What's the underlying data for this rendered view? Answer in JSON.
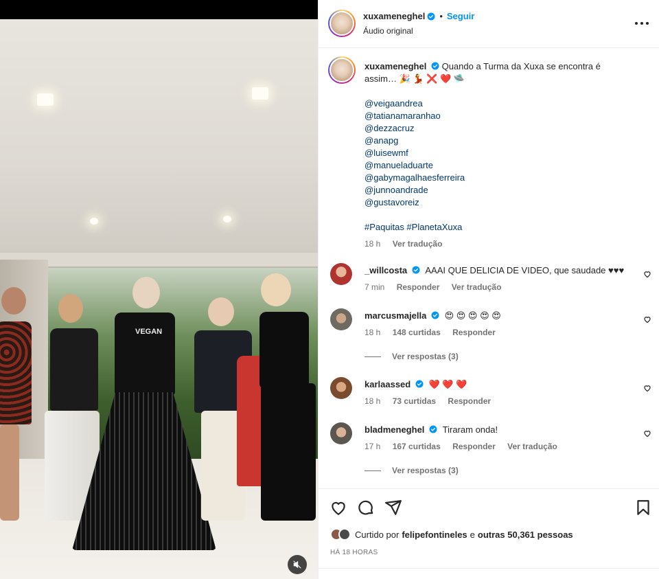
{
  "post": {
    "username": "xuxameneghel",
    "follow_label": "Seguir",
    "separator": "•",
    "audio_label": "Áudio original",
    "caption_line1": "Quando a Turma da Xuxa se encontra é",
    "caption_line2": "assim… 🎉 💃 ❌ ❤️ 🛸",
    "mentions": [
      "@veigaandrea",
      "@tatianamaranhao",
      "@dezzacruz",
      "@anapg",
      "@luisewmf",
      "@manueladuarte",
      "@gabymagalhaesferreira",
      "@junnoandrade",
      "@gustavoreiz"
    ],
    "hashtags": "#Paquitas #PlanetaXuxa",
    "caption_time": "18 h",
    "caption_translate": "Ver tradução"
  },
  "comments": [
    {
      "user": "_willcosta",
      "text": "AAAI QUE DELICIA DE VIDEO, que saudade ♥♥♥",
      "time": "7 min",
      "likes": "",
      "reply": "Responder",
      "translate": "Ver tradução",
      "avatar_color": "#b0332f"
    },
    {
      "user": "marcusmajella",
      "text": "😍 😍 😍 😍 😍",
      "time": "18 h",
      "likes": "148 curtidas",
      "reply": "Responder",
      "translate": "",
      "view_replies": "Ver respostas (3)",
      "avatar_color": "#6e6a62"
    },
    {
      "user": "karlaassed",
      "text": "❤️ ❤️ ❤️",
      "time": "18 h",
      "likes": "73 curtidas",
      "reply": "Responder",
      "translate": "",
      "avatar_color": "#7a4b2d"
    },
    {
      "user": "bladmeneghel",
      "text": "Tiraram onda!",
      "time": "17 h",
      "likes": "167 curtidas",
      "reply": "Responder",
      "translate": "Ver tradução",
      "view_replies": "Ver respostas (3)",
      "avatar_color": "#5b5750"
    }
  ],
  "likes": {
    "prefix": "Curtido por",
    "user": "felipefontineles",
    "middle": "e",
    "others": "outras 50,361 pessoas"
  },
  "time_ago": "HÁ 18 HORAS",
  "colors": {
    "link": "#00376b",
    "follow": "#0095f6",
    "verified": "#0095f6",
    "muted": "#737373"
  },
  "icons": [
    "verified-badge-icon",
    "more-options-icon",
    "heart-icon",
    "comment-icon",
    "share-icon",
    "bookmark-icon",
    "mute-icon"
  ],
  "video_overlay": {
    "shirt_text": "VEGAN"
  }
}
